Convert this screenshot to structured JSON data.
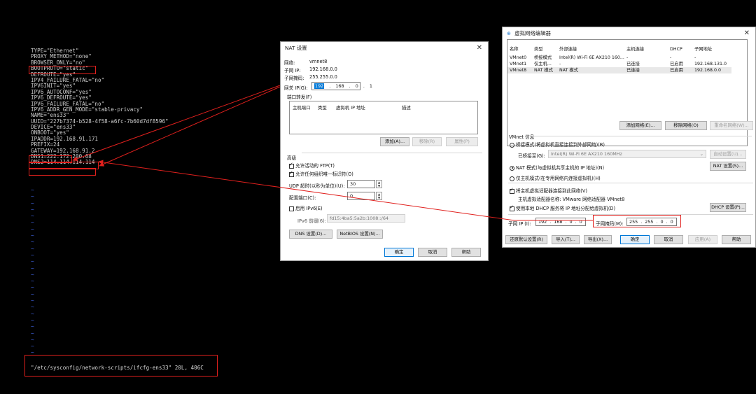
{
  "terminal": {
    "lines": [
      "TYPE=\"Ethernet\"",
      "PROXY_METHOD=\"none\"",
      "BROWSER_ONLY=\"no\"",
      "BOOTPROTO=\"static\"",
      "DEFROUTE=\"yes\"",
      "IPV4_FAILURE_FATAL=\"no\"",
      "IPV6INIT=\"yes\"",
      "IPV6_AUTOCONF=\"yes\"",
      "IPV6_DEFROUTE=\"yes\"",
      "IPV6_FAILURE_FATAL=\"no\"",
      "IPV6_ADDR_GEN_MODE=\"stable-privacy\"",
      "NAME=\"ens33\"",
      "UUID=\"227b7374-b528-4f58-a6fc-7b60d7df8596\"",
      "DEVICE=\"ens33\"",
      "ONBOOT=\"yes\"",
      "IPADDR=192.168.91.171",
      "PREFIX=24",
      "GATEWAY=192.168.91.2",
      "DNS1=222.172.200.68",
      "DNS2=114.114.114.114"
    ],
    "tilde_char": "~",
    "tilde_count": 26,
    "status_line": "\"/etc/sysconfig/network-scripts/ifcfg-ens33\" 20L, 406C"
  },
  "nat_dialog": {
    "title": "NAT 设置",
    "network_label": "网络:",
    "network_value": "vmnet8",
    "subnet_ip_label": "子网 IP:",
    "subnet_ip_value": "192.168.0.0",
    "subnet_mask_label": "子网掩码:",
    "subnet_mask_value": "255.255.0.0",
    "gateway_label": "网关 IP(G):",
    "gateway_value": [
      "192",
      "168",
      "0",
      "1"
    ],
    "port_forward_label": "端口转发(F)",
    "port_cols": [
      "主机端口",
      "类型",
      "虚拟机 IP 地址",
      "描述"
    ],
    "add_btn": "添加(A)...",
    "remove_btn": "移除(R)",
    "props_btn": "属性(P)",
    "advanced_label": "高级",
    "allow_ftp": "允许活动的 FTP(T)",
    "allow_oui": "允许任何组织唯一标识符(O)",
    "udp_timeout_label": "UDP 超时(以秒为单位)(U):",
    "udp_timeout_value": "30",
    "config_port_label": "配置端口(C):",
    "config_port_value": "0",
    "enable_ipv6": "启用 IPv6(E)",
    "ipv6_prefix_label": "IPv6 前缀(6):",
    "ipv6_prefix_value": "fd15:4ba5:5a2b:1008::/64",
    "dns_btn": "DNS 设置(D)...",
    "netbios_btn": "NetBIOS 设置(N)...",
    "ok_btn": "确定",
    "cancel_btn": "取消",
    "help_btn": "帮助",
    "close_icon": "✕"
  },
  "vne_dialog": {
    "title": "虚拟网络编辑器",
    "close_icon": "✕",
    "table_headers": [
      "名称",
      "类型",
      "外部连接",
      "主机连接",
      "DHCP",
      "子网地址"
    ],
    "rows": [
      [
        "VMnet0",
        "桥接模式",
        "Intel(R) Wi-Fi 6E AX210 160...",
        "-",
        "-",
        "-"
      ],
      [
        "VMnet1",
        "仅主机...",
        "-",
        "已连接",
        "已启用",
        "192.168.131.0"
      ],
      [
        "VMnet8",
        "NAT 模式",
        "NAT 模式",
        "已连接",
        "已启用",
        "192.168.0.0"
      ]
    ],
    "add_network_btn": "添加网络(E)...",
    "remove_network_btn": "移除网络(O)",
    "rename_network_btn": "重命名网络(W)...",
    "vmnet_info_label": "VMnet 信息",
    "bridged_label": "桥接模式(将虚拟机直接连接到外部网络)(B)",
    "bridged_to_label": "已桥接至(G):",
    "bridged_to_value": "Intel(R) Wi-Fi 6E AX210 160MHz",
    "auto_settings_btn": "自动设置(U)...",
    "nat_label": "NAT 模式(与虚拟机共享主机的 IP 地址)(N)",
    "nat_settings_btn": "NAT 设置(S)...",
    "hostonly_label": "仅主机模式(在专用网络内连接虚拟机)(H)",
    "connect_host_adapter": "将主机虚拟适配器连接到此网络(V)",
    "host_adapter_name_label": "主机虚拟适配器名称: VMware 网络适配器 VMnet8",
    "use_dhcp": "使用本地 DHCP 服务将 IP 地址分配给虚拟机(D)",
    "dhcp_settings_btn": "DHCP 设置(P)...",
    "subnet_ip_label": "子网 IP (I):",
    "subnet_ip_value": [
      "192",
      "168",
      "0",
      "0"
    ],
    "subnet_mask_label": "子网掩码(M):",
    "subnet_mask_value": [
      "255",
      "255",
      "0",
      "0"
    ],
    "restore_btn": "还原默认设置(R)",
    "import_btn": "导入(T)...",
    "export_btn": "导出(X)...",
    "ok_btn": "确定",
    "cancel_btn": "取消",
    "apply_btn": "应用(A)",
    "help_btn": "帮助"
  },
  "colors": {
    "annotation_red": "#e0201d",
    "vim_tilde_blue": "#3f63e0",
    "selection_blue": "#0078d7"
  }
}
